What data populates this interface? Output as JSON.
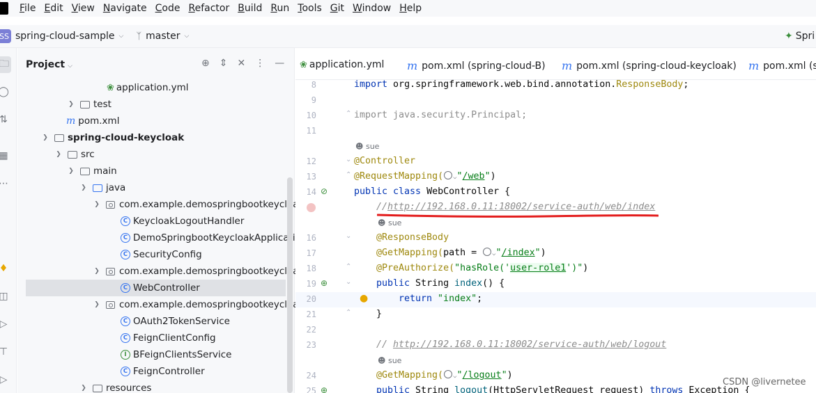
{
  "menu": [
    "File",
    "Edit",
    "View",
    "Navigate",
    "Code",
    "Refactor",
    "Build",
    "Run",
    "Tools",
    "Git",
    "Window",
    "Help"
  ],
  "toolbar": {
    "project_badge": "SS",
    "project_name": "spring-cloud-sample",
    "branch": "master",
    "run_config": "Spri"
  },
  "project_panel": {
    "title": "Project",
    "tree": [
      {
        "label": "application.yml",
        "icon": "yaml"
      },
      {
        "label": "test",
        "icon": "folder"
      },
      {
        "label": "pom.xml",
        "icon": "maven"
      },
      {
        "label": "spring-cloud-keycloak",
        "icon": "folder"
      },
      {
        "label": "src",
        "icon": "folder"
      },
      {
        "label": "main",
        "icon": "folder"
      },
      {
        "label": "java",
        "icon": "folder"
      },
      {
        "label": "com.example.demospringbootkeycloak",
        "icon": "package"
      },
      {
        "label": "KeycloakLogoutHandler",
        "icon": "class"
      },
      {
        "label": "DemoSpringbootKeycloakApplication",
        "icon": "class"
      },
      {
        "label": "SecurityConfig",
        "icon": "class"
      },
      {
        "label": "com.example.demospringbootkeycloak.c",
        "icon": "package"
      },
      {
        "label": "WebController",
        "icon": "class"
      },
      {
        "label": "com.example.demospringbootkeycloak.f",
        "icon": "package"
      },
      {
        "label": "OAuth2TokenService",
        "icon": "class"
      },
      {
        "label": "FeignClientConfig",
        "icon": "class"
      },
      {
        "label": "BFeignClientsService",
        "icon": "interface"
      },
      {
        "label": "FeignController",
        "icon": "class"
      },
      {
        "label": "resources",
        "icon": "folder"
      }
    ]
  },
  "tabs": [
    {
      "label": "application.yml"
    },
    {
      "label": "pom.xml (spring-cloud-B)"
    },
    {
      "label": "pom.xml (spring-cloud-keycloak)"
    },
    {
      "label": "pom.xml (sp"
    }
  ],
  "editor": {
    "author_hint": "sue",
    "lines": {
      "l8": {
        "num": "8",
        "kw": "import",
        "text": " org.springframework.web.bind.annotation.",
        "ann": "ResponseBody",
        "end": ";"
      },
      "l9": {
        "num": "9"
      },
      "l10": {
        "num": "10",
        "text": "import java.security.Principal;"
      },
      "l11": {
        "num": "11"
      },
      "l12": {
        "num": "12",
        "ann": "@Controller"
      },
      "l13": {
        "num": "13",
        "ann": "@RequestMapping(",
        "q1": "\"",
        "url": "/web",
        "q2": "\"",
        "end": ")"
      },
      "l14": {
        "num": "14",
        "kw1": "public class",
        "text": " WebController {"
      },
      "l15": {
        "cmt": "//",
        "url": "http://192.168.0.11:18002/service-auth/web/index"
      },
      "l16": {
        "num": "16",
        "ann": "@ResponseBody"
      },
      "l17": {
        "num": "17",
        "ann": "@GetMapping(",
        "text": "path = ",
        "q1": "\"",
        "url": "/index",
        "q2": "\"",
        "end": ")"
      },
      "l18": {
        "num": "18",
        "ann": "@PreAuthorize(",
        "str1": "\"hasRole(",
        "str2": "'",
        "url": "user-role1",
        "str3": "')\"",
        "end": ")"
      },
      "l19": {
        "num": "19",
        "kw": "public",
        "text": " String ",
        "mth": "index",
        "end": "() {"
      },
      "l20": {
        "num": "20",
        "kw": "return",
        "str": " \"index\"",
        "end": ";"
      },
      "l21": {
        "num": "21",
        "text": "}"
      },
      "l22": {
        "num": "22"
      },
      "l23": {
        "num": "23",
        "cmt": "// ",
        "url": "http://192.168.0.11:18002/service-auth/web/logout"
      },
      "l24": {
        "num": "24",
        "ann": "@GetMapping(",
        "q1": "\"",
        "url": "/logout",
        "q2": "\"",
        "end": ")"
      },
      "l25": {
        "num": "25",
        "kw": "public",
        "text": " String ",
        "mth": "logout",
        "rest": "(HttpServletRequest request) ",
        "kw2": "throws",
        "rest2": " Exception {"
      }
    }
  },
  "watermark": "CSDN @livernetee",
  "colors": {
    "accent_blue": "#3574f0",
    "keyword": "#0033b3",
    "annotation": "#9e880d",
    "string": "#067d17",
    "underline_mark": "#e31b1b"
  }
}
